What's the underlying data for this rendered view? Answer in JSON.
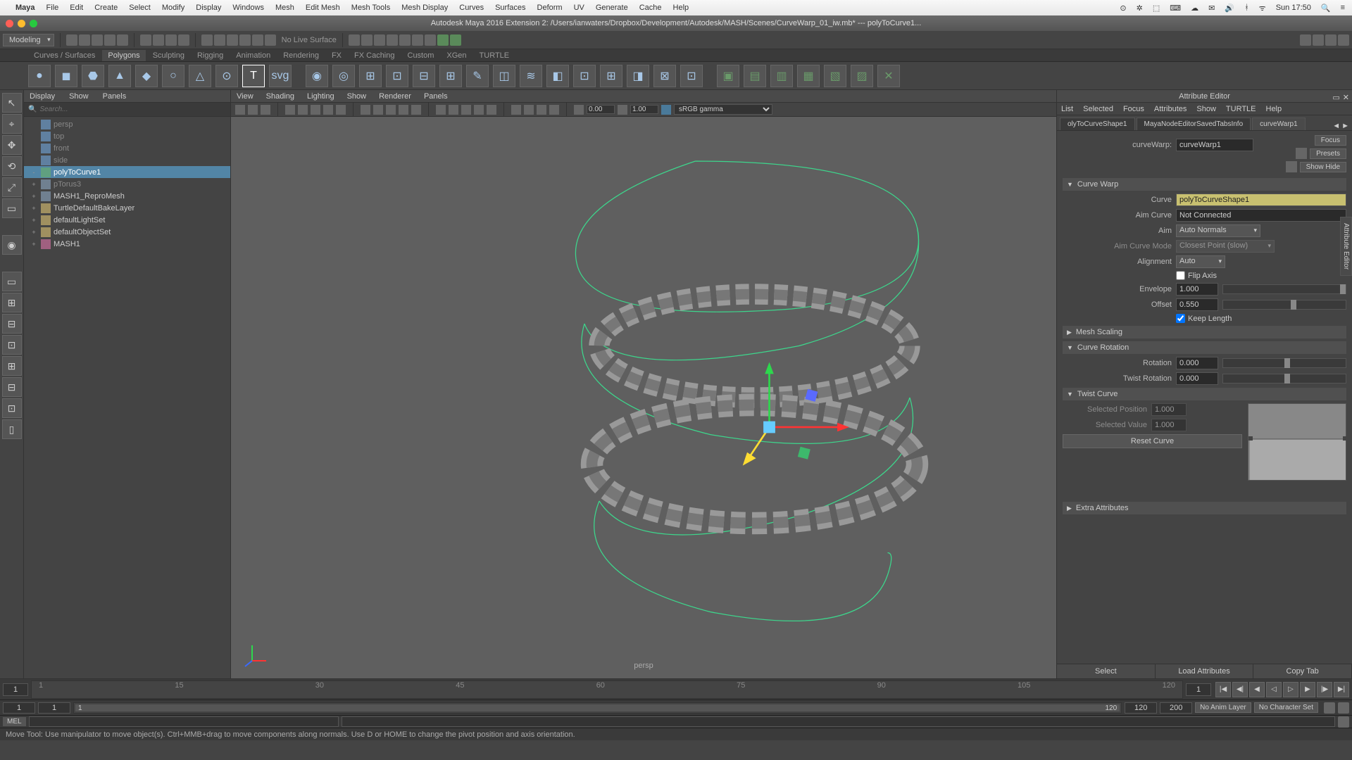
{
  "macmenu": {
    "app": "Maya",
    "items": [
      "File",
      "Edit",
      "Create",
      "Select",
      "Modify",
      "Display",
      "Windows",
      "Mesh",
      "Edit Mesh",
      "Mesh Tools",
      "Mesh Display",
      "Curves",
      "Surfaces",
      "Deform",
      "UV",
      "Generate",
      "Cache",
      "Help"
    ],
    "clock": "Sun 17:50"
  },
  "titlebar": {
    "text": "Autodesk Maya 2016 Extension 2: /Users/ianwaters/Dropbox/Development/Autodesk/MASH/Scenes/CurveWarp_01_iw.mb*  ---  polyToCurve1..."
  },
  "workspace": {
    "mode": "Modeling",
    "live": "No Live Surface"
  },
  "shelf": {
    "tabs": [
      "Curves / Surfaces",
      "Polygons",
      "Sculpting",
      "Rigging",
      "Animation",
      "Rendering",
      "FX",
      "FX Caching",
      "Custom",
      "XGen",
      "TURTLE"
    ],
    "active": 1
  },
  "outliner": {
    "menus": [
      "Display",
      "Show",
      "Panels"
    ],
    "search_placeholder": "Search...",
    "items": [
      {
        "name": "persp",
        "type": "cam",
        "dim": true
      },
      {
        "name": "top",
        "type": "cam",
        "dim": true
      },
      {
        "name": "front",
        "type": "cam",
        "dim": true
      },
      {
        "name": "side",
        "type": "cam",
        "dim": true
      },
      {
        "name": "polyToCurve1",
        "type": "curve",
        "selected": true,
        "expand": "-"
      },
      {
        "name": "pTorus3",
        "type": "mesh",
        "dim": true,
        "expand": "+"
      },
      {
        "name": "MASH1_ReproMesh",
        "type": "mesh",
        "expand": "+"
      },
      {
        "name": "TurtleDefaultBakeLayer",
        "type": "light",
        "expand": "+"
      },
      {
        "name": "defaultLightSet",
        "type": "light",
        "expand": "+"
      },
      {
        "name": "defaultObjectSet",
        "type": "light",
        "expand": "+"
      },
      {
        "name": "MASH1",
        "type": "mash",
        "expand": "+"
      }
    ]
  },
  "viewport": {
    "menus": [
      "View",
      "Shading",
      "Lighting",
      "Show",
      "Renderer",
      "Panels"
    ],
    "val1": "0.00",
    "val2": "1.00",
    "colorspace": "sRGB gamma",
    "camera": "persp"
  },
  "attr": {
    "title": "Attribute Editor",
    "menus": [
      "List",
      "Selected",
      "Focus",
      "Attributes",
      "Show",
      "TURTLE",
      "Help"
    ],
    "tabs": [
      "olyToCurveShape1",
      "MayaNodeEditorSavedTabsInfo",
      "curveWarp1"
    ],
    "active_tab": 2,
    "focus": "Focus",
    "presets": "Presets",
    "showhide": "Show   Hide",
    "node_label": "curveWarp:",
    "node_name": "curveWarp1",
    "sections": {
      "curve_warp": {
        "title": "Curve Warp",
        "curve_label": "Curve",
        "curve_value": "polyToCurveShape1",
        "aim_curve_label": "Aim Curve",
        "aim_curve_value": "Not Connected",
        "aim_label": "Aim",
        "aim_value": "Auto Normals",
        "aim_mode_label": "Aim Curve Mode",
        "aim_mode_value": "Closest Point (slow)",
        "align_label": "Alignment",
        "align_value": "Auto",
        "flip_label": "Flip Axis",
        "env_label": "Envelope",
        "env_value": "1.000",
        "offset_label": "Offset",
        "offset_value": "0.550",
        "keep_label": "Keep Length"
      },
      "mesh_scaling": "Mesh Scaling",
      "curve_rotation": {
        "title": "Curve Rotation",
        "rot_label": "Rotation",
        "rot_value": "0.000",
        "twist_label": "Twist Rotation",
        "twist_value": "0.000"
      },
      "twist_curve": {
        "title": "Twist Curve",
        "selpos_label": "Selected Position",
        "selpos_value": "1.000",
        "selval_label": "Selected Value",
        "selval_value": "1.000",
        "reset": "Reset Curve"
      },
      "extra": "Extra Attributes"
    },
    "footer": [
      "Select",
      "Load Attributes",
      "Copy Tab"
    ],
    "side_tab": "Attribute Editor"
  },
  "timeline": {
    "start": "1",
    "ticks": [
      "1",
      "15",
      "30",
      "45",
      "60",
      "75",
      "90",
      "105",
      "120"
    ],
    "current": "1",
    "range_start": "1",
    "range_in": "1",
    "range_out": "120",
    "range_end": "120",
    "range_max": "200",
    "anim_layer": "No Anim Layer",
    "char_set": "No Character Set"
  },
  "cmd": {
    "lang": "MEL"
  },
  "help": "Move Tool: Use manipulator to move object(s). Ctrl+MMB+drag to move components along normals. Use D or HOME to change the pivot position and axis orientation."
}
